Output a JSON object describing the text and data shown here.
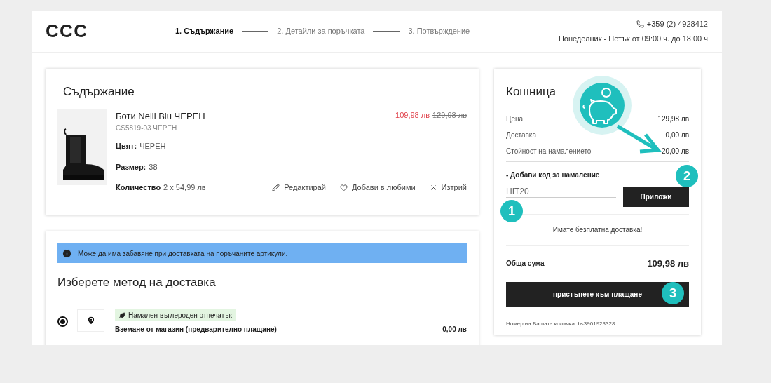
{
  "header": {
    "logo": "CCC",
    "steps": [
      {
        "label": "1. Съдържание",
        "selected": true
      },
      {
        "label": "2. Детайли за поръчката",
        "selected": false
      },
      {
        "label": "3. Потвърждение",
        "selected": false
      }
    ],
    "phone": "+359 (2) 4928412",
    "hours": "Понеделник - Петък от 09:00 ч. до 18:00 ч"
  },
  "contents": {
    "title": "Съдържание",
    "item": {
      "kind": "picture",
      "name": "Боти Nelli Blu ЧЕРЕН",
      "code": "CS5819-03 ЧЕРЕН",
      "color_label": "Цвят:",
      "color_value": "ЧЕРЕН",
      "size_label": "Размер:",
      "size_value": "38",
      "qty_label": "Количество",
      "qty_value": "2 x 54,99 лв",
      "price": "109,98 лв",
      "old_price": "129,98 лв",
      "actions": [
        {
          "kind": "edit",
          "label": "Редактирай"
        },
        {
          "kind": "favorite",
          "label": "Добави в любими"
        },
        {
          "kind": "delete",
          "label": "Изтрий"
        }
      ]
    }
  },
  "delivery": {
    "notice": "Може да има забавяне при доставката на поръчаните артикули.",
    "title": "Изберете метод на доставка",
    "options": [
      {
        "selected": true,
        "tag": "Намален въглероден отпечатък",
        "label": "Вземане от магазин (предварително плащане)",
        "price": "0,00 лв"
      }
    ]
  },
  "cart": {
    "title": "Кошница",
    "rows": [
      {
        "label": "Цена",
        "value": "129,98 лв"
      },
      {
        "label": "Доставка",
        "value": "0,00 лв"
      },
      {
        "label": "Стойност на намалението",
        "value": "-20,00 лв"
      }
    ],
    "promo_label": "- Добави код за намаление",
    "promo_value": "HIT20",
    "apply": "Приложи",
    "free_delivery": "Имате безплатна доставка!",
    "total_label": "Обща сума",
    "total_value": "109,98 лв",
    "checkout": "пристъпете към плащане",
    "cart_number": "Номер на Вашата количка: bs3901923328"
  },
  "annotations": [
    "1",
    "2",
    "3"
  ]
}
